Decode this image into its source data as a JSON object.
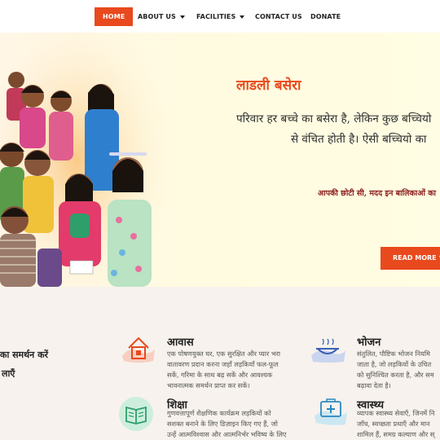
{
  "nav": {
    "items": [
      {
        "label": "HOME",
        "active": true
      },
      {
        "label": "ABOUT US",
        "dropdown": true
      },
      {
        "label": "FACILITIES",
        "dropdown": true
      },
      {
        "label": "CONTACT US"
      },
      {
        "label": "DONATE"
      }
    ]
  },
  "hero": {
    "title": "लाडली बसेरा",
    "text_line1": "परिवार हर बच्चे का बसेरा है, लेकिन कुछ बच्चियो",
    "text_line2": "से वंचित होती है। ऐसी बच्चियो का",
    "subtext": "आपकी छोटी सी, मदद इन बालिकाओं का",
    "read_more": "READ MORE",
    "heart_icon": "heart-icon"
  },
  "support": {
    "line1": "का समर्थन करें",
    "line2": "लाएँ"
  },
  "services": [
    {
      "icon": "house-icon",
      "title": "आवास",
      "desc": [
        "एक पोषणयुक्त घर, एक सुरक्षित और प्यार भरा",
        "वातावरण प्रदान करना जहाँ लड़कियाँ फल-फूल",
        "सकें, गरिमा के साथ बढ़ सकें और आवश्यक",
        "भावनात्मक समर्थन प्राप्त कर सकें।"
      ]
    },
    {
      "icon": "food-bowl-icon",
      "title": "भोजन",
      "desc": [
        "संतुलित, पौष्टिक भोजन नियमि",
        "जाता है, जो लड़कियों के उचित",
        "को सुनिश्चित करता है, और सम",
        "बढ़ावा देता है।"
      ]
    },
    {
      "icon": "book-icon",
      "title": "शिक्षा",
      "desc": [
        "गुणवत्तापूर्ण शैक्षणिक कार्यक्रम लड़कियों को",
        "सशक्त बनाने के लिए डिज़ाइन किए गए हैं, जो",
        "उन्हें आत्मविश्वास और आत्मनिर्भर भविष्य के लिए"
      ]
    },
    {
      "icon": "first-aid-icon",
      "title": "स्वास्थ्य",
      "desc": [
        "व्यापक स्वास्थ्य सेवाएँ, जिनमें नि",
        "जाँच, स्वच्छता प्रथाएँ और मान",
        "शामिल हैं, समग्र कल्याण और स्"
      ]
    }
  ],
  "colors": {
    "accent": "#e8491d",
    "hero_bg": "#fffbe0",
    "section_bg": "#f7f2ed",
    "subtext": "#8a1c1c"
  }
}
